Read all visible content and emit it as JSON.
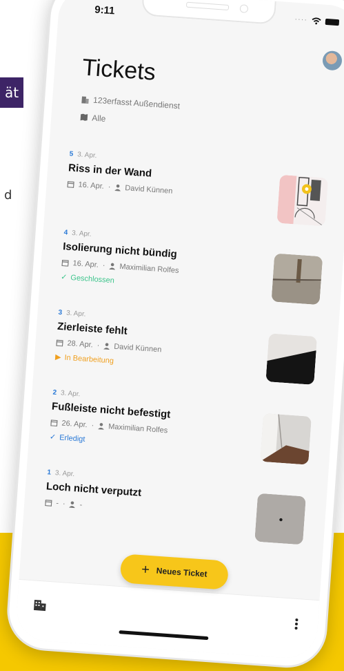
{
  "side_tag": {
    "text": "ät"
  },
  "side_letter": {
    "text": "d"
  },
  "status_bar": {
    "time": "9:11"
  },
  "header": {
    "title": "Tickets",
    "company": "123erfasst Außendienst",
    "filter": "Alle"
  },
  "tickets": [
    {
      "number": "5",
      "created": "3. Apr.",
      "title": "Riss in der Wand",
      "due": "16. Apr.",
      "assignee": "David Künnen",
      "status": "",
      "thumb": "map"
    },
    {
      "number": "4",
      "created": "3. Apr.",
      "title": "Isolierung nicht bündig",
      "due": "16. Apr.",
      "assignee": "Maximilian Rolfes",
      "status": "Geschlossen",
      "status_color": "#3cc48b",
      "thumb": "wall"
    },
    {
      "number": "3",
      "created": "3. Apr.",
      "title": "Zierleiste fehlt",
      "due": "28. Apr.",
      "assignee": "David Künnen",
      "status": "In Bearbeitung",
      "status_color": "#f0a020",
      "thumb": "dark-corner"
    },
    {
      "number": "2",
      "created": "3. Apr.",
      "title": "Fußleiste nicht befestigt",
      "due": "26. Apr.",
      "assignee": "Maximilian Rolfes",
      "status": "Erledigt",
      "status_color": "#2a79d6",
      "thumb": "floor"
    },
    {
      "number": "1",
      "created": "3. Apr.",
      "title": "Loch nicht verputzt",
      "due": "-",
      "assignee": "-",
      "status": "",
      "thumb": "hole"
    }
  ],
  "new_ticket_button": {
    "label": "Neues Ticket"
  },
  "colors": {
    "accent_yellow": "#f7c61a",
    "number_blue": "#2a79d6",
    "band_yellow": "#f5c800",
    "side_tag_purple": "#3d2466"
  }
}
